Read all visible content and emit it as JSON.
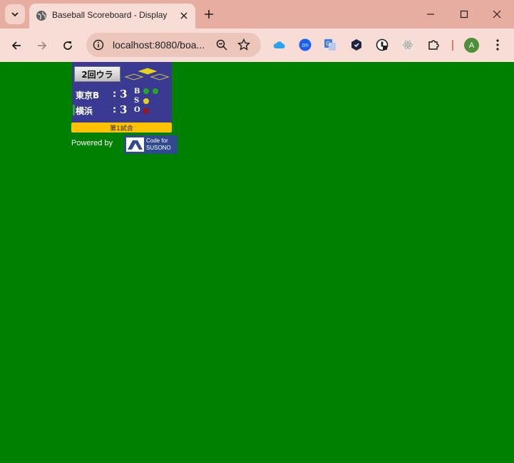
{
  "browser": {
    "tab_title": "Baseball Scoreboard - Display",
    "url": "localhost:8080/boa...",
    "profile_initial": "A",
    "icons": {
      "tab_search": "chevron-down-icon",
      "favicon": "globe-icon",
      "tab_close": "close-icon",
      "new_tab": "plus-icon",
      "minimize": "minimize-icon",
      "maximize": "maximize-icon",
      "window_close": "close-icon",
      "back": "arrow-left-icon",
      "forward": "arrow-right-icon",
      "reload": "reload-icon",
      "site_info": "info-icon",
      "zoom": "zoom-icon",
      "bookmark": "star-icon",
      "extensions": [
        "cloud-icon",
        "zoom-meetings-icon",
        "translate-icon",
        "shield-icon",
        "password-manager-icon",
        "react-icon",
        "puzzle-icon"
      ],
      "menu": "kebab-menu-icon"
    }
  },
  "scoreboard": {
    "inning": "2回ウラ",
    "teams": [
      {
        "name": "東京B",
        "colon": ":",
        "score": "3"
      },
      {
        "name": "横浜",
        "colon": ":",
        "score": "3"
      }
    ],
    "count": {
      "labels": {
        "balls": "B",
        "strikes": "S",
        "outs": "O"
      },
      "balls": 2,
      "strikes": 1,
      "outs": 1
    },
    "bases": {
      "first": false,
      "second": true,
      "third": false
    },
    "game_label": "第1試合",
    "powered_by": "Powered by",
    "sponsor": {
      "line1": "Code for",
      "line2": "SUSONO"
    },
    "colors": {
      "background": "#008000",
      "board": "#3a3a93",
      "ball_dot": "#22aa22",
      "strike_dot": "#e6d21a",
      "out_dot": "#a01515",
      "occupied_base": "#e6d21a",
      "game_label_bg": "#ffc200"
    }
  }
}
